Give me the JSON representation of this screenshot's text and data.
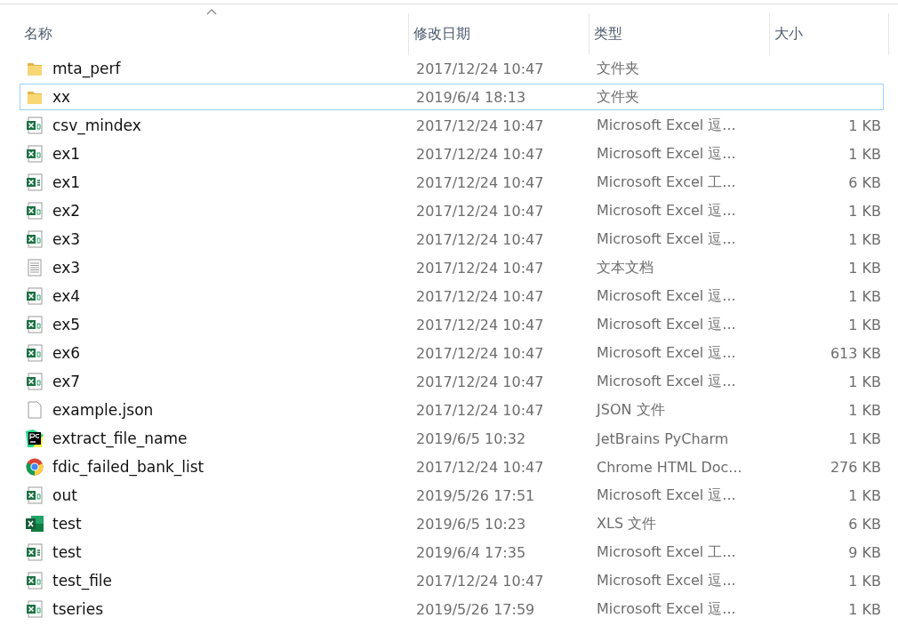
{
  "columns": [
    {
      "label": "名称",
      "sorted": true
    },
    {
      "label": "修改日期",
      "sorted": false
    },
    {
      "label": "类型",
      "sorted": false
    },
    {
      "label": "大小",
      "sorted": false
    }
  ],
  "rows": [
    {
      "kind": "folder",
      "name": "mta_perf",
      "date": "2017/12/24 10:47",
      "type": "文件夹",
      "selected": false
    },
    {
      "kind": "folder",
      "name": "xx",
      "date": "2019/6/4 18:13",
      "type": "文件夹",
      "selected": true
    },
    {
      "kind": "csv",
      "name": "csv_mindex",
      "date": "2017/12/24 10:47",
      "type": "Microsoft Excel 逗...",
      "size": "1 KB",
      "selected": false
    },
    {
      "kind": "csv",
      "name": "ex1",
      "date": "2017/12/24 10:47",
      "type": "Microsoft Excel 逗...",
      "size": "1 KB",
      "selected": false
    },
    {
      "kind": "xlsx",
      "name": "ex1",
      "date": "2017/12/24 10:47",
      "type": "Microsoft Excel 工...",
      "size": "6 KB",
      "selected": false
    },
    {
      "kind": "csv",
      "name": "ex2",
      "date": "2017/12/24 10:47",
      "type": "Microsoft Excel 逗...",
      "size": "1 KB",
      "selected": false
    },
    {
      "kind": "csv",
      "name": "ex3",
      "date": "2017/12/24 10:47",
      "type": "Microsoft Excel 逗...",
      "size": "1 KB",
      "selected": false
    },
    {
      "kind": "text",
      "name": "ex3",
      "date": "2017/12/24 10:47",
      "type": "文本文档",
      "size": "1 KB",
      "selected": false
    },
    {
      "kind": "csv",
      "name": "ex4",
      "date": "2017/12/24 10:47",
      "type": "Microsoft Excel 逗...",
      "size": "1 KB",
      "selected": false
    },
    {
      "kind": "csv",
      "name": "ex5",
      "date": "2017/12/24 10:47",
      "type": "Microsoft Excel 逗...",
      "size": "1 KB",
      "selected": false
    },
    {
      "kind": "csv",
      "name": "ex6",
      "date": "2017/12/24 10:47",
      "type": "Microsoft Excel 逗...",
      "size": "613 KB",
      "selected": false
    },
    {
      "kind": "csv",
      "name": "ex7",
      "date": "2017/12/24 10:47",
      "type": "Microsoft Excel 逗...",
      "size": "1 KB",
      "selected": false
    },
    {
      "kind": "blank",
      "name": "example.json",
      "date": "2017/12/24 10:47",
      "type": "JSON 文件",
      "size": "1 KB",
      "selected": false
    },
    {
      "kind": "pycharm",
      "name": "extract_file_name",
      "date": "2019/6/5 10:32",
      "type": "JetBrains PyCharm",
      "size": "1 KB",
      "selected": false
    },
    {
      "kind": "chrome",
      "name": "fdic_failed_bank_list",
      "date": "2017/12/24 10:47",
      "type": "Chrome HTML Doc...",
      "size": "276 KB",
      "selected": false
    },
    {
      "kind": "csv",
      "name": "out",
      "date": "2019/5/26 17:51",
      "type": "Microsoft Excel 逗...",
      "size": "1 KB",
      "selected": false
    },
    {
      "kind": "xls",
      "name": "test",
      "date": "2019/6/5 10:23",
      "type": "XLS 文件",
      "size": "6 KB",
      "selected": false
    },
    {
      "kind": "xlsx",
      "name": "test",
      "date": "2019/6/4 17:35",
      "type": "Microsoft Excel 工...",
      "size": "9 KB",
      "selected": false
    },
    {
      "kind": "csv",
      "name": "test_file",
      "date": "2017/12/24 10:47",
      "type": "Microsoft Excel 逗...",
      "size": "1 KB",
      "selected": false
    },
    {
      "kind": "csv",
      "name": "tseries",
      "date": "2019/5/26 17:59",
      "type": "Microsoft Excel 逗...",
      "size": "1 KB",
      "selected": false
    }
  ]
}
